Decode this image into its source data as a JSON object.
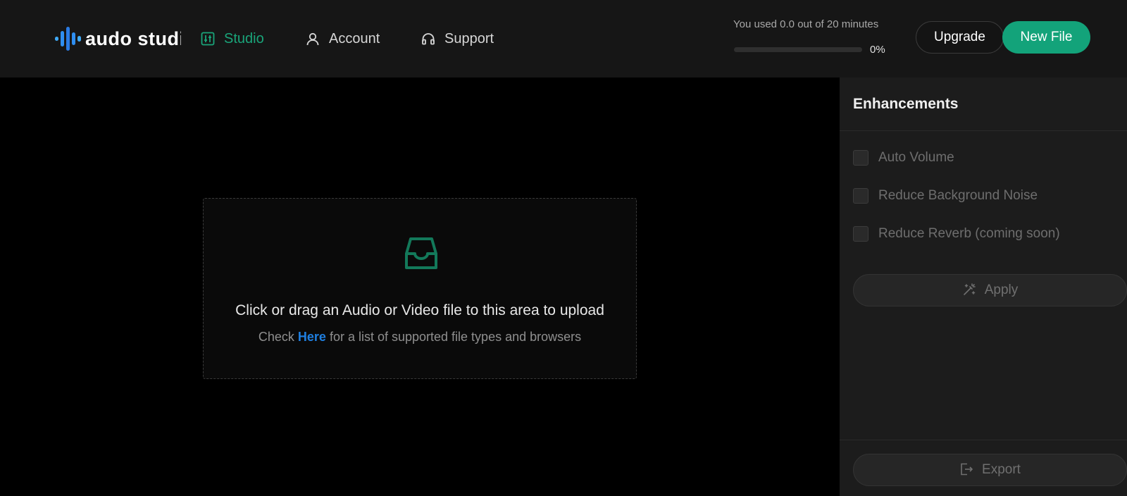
{
  "brand": {
    "name": "audo studio"
  },
  "nav": {
    "items": [
      {
        "label": "Studio",
        "icon": "sliders-icon",
        "active": true
      },
      {
        "label": "Account",
        "icon": "user-icon"
      },
      {
        "label": "Support",
        "icon": "headphones-icon"
      }
    ]
  },
  "usage": {
    "text": "You used 0.0 out of 20 minutes",
    "percent_label": "0%",
    "progress_fraction": 0
  },
  "header_buttons": {
    "upgrade": "Upgrade",
    "new_file": "New File"
  },
  "upload": {
    "icon": "inbox-icon",
    "title": "Click or drag an Audio or Video file to this area to upload",
    "sub_prefix": "Check",
    "sub_link": "Here",
    "sub_suffix": "for a list of supported file types and browsers"
  },
  "enhancements": {
    "title": "Enhancements",
    "options": [
      {
        "label": "Auto Volume",
        "checked": false
      },
      {
        "label": "Reduce Background Noise",
        "checked": false
      },
      {
        "label": "Reduce Reverb (coming soon)",
        "checked": false
      }
    ],
    "apply_label": "Apply",
    "export_label": "Export"
  },
  "colors": {
    "accent": "#13a37a",
    "link": "#1f7fe0",
    "topbar_bg": "#161616",
    "panel_bg": "#1c1c1c"
  }
}
